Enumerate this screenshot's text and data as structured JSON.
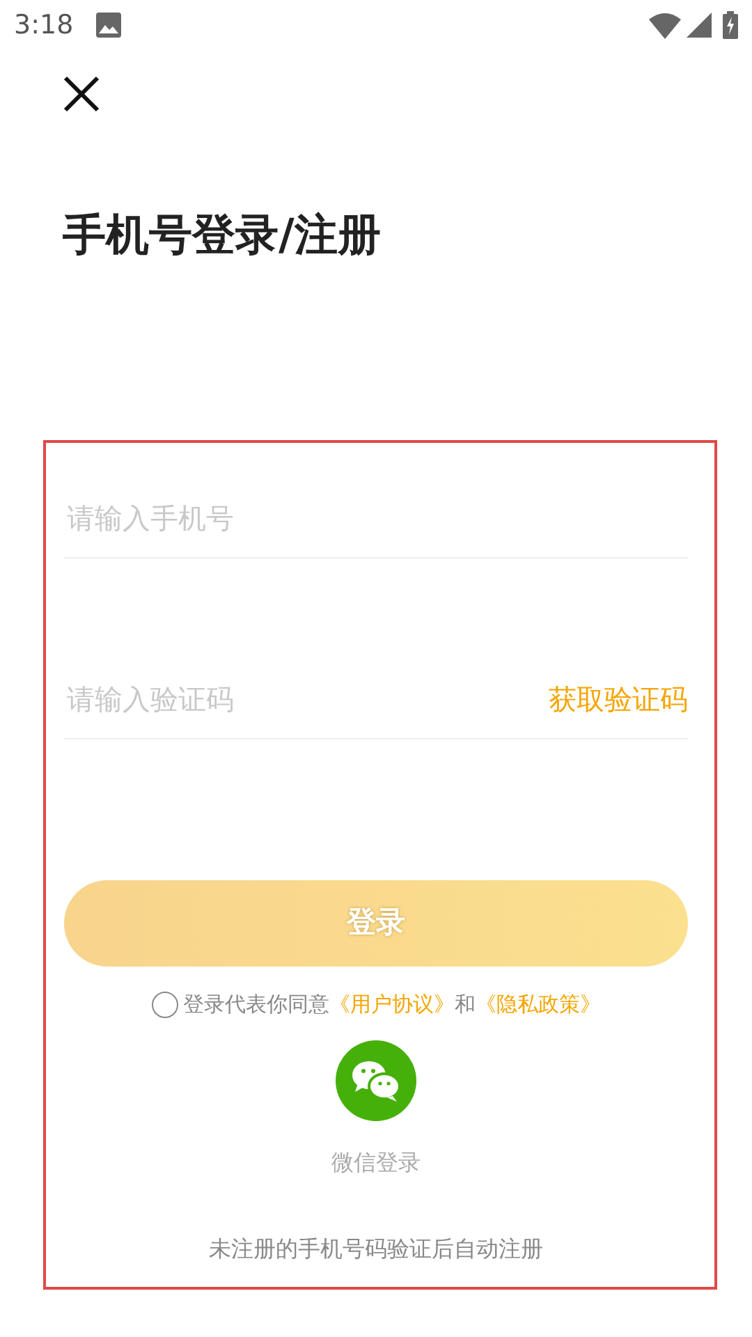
{
  "status_bar": {
    "time": "3:18"
  },
  "title": "手机号登录/注册",
  "phone_field": {
    "placeholder": "请输入手机号"
  },
  "code_field": {
    "placeholder": "请输入验证码",
    "action": "获取验证码"
  },
  "login_button": {
    "label": "登录",
    "disabled": true
  },
  "agreement": {
    "checked": false,
    "parts": [
      {
        "kind": "text",
        "text": "登录代表你同意"
      },
      {
        "kind": "link",
        "text": "《用户协议》"
      },
      {
        "kind": "text",
        "text": "和"
      },
      {
        "kind": "link",
        "text": "《隐私政策》"
      }
    ]
  },
  "wechat_login": {
    "label": "微信登录"
  },
  "footer_note": "未注册的手机号码验证后自动注册"
}
